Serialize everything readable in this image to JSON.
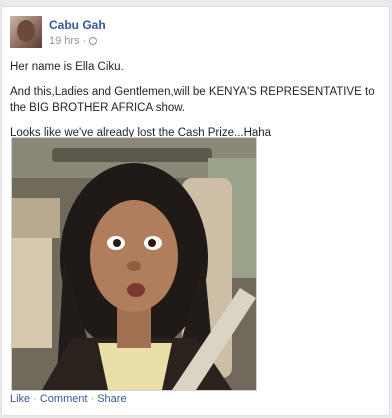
{
  "post": {
    "author": "Cabu Gah",
    "time": "19 hrs",
    "time_separator": "·",
    "paragraphs": [
      "Her name is Ella Ciku.",
      "And this,Ladies and Gentlemen,will be KENYA'S REPRESENTATIVE to the BIG BROTHER AFRICA show.",
      "Looks like we've already lost the Cash Prize...Haha"
    ],
    "photo_icon": "photo-of-woman-in-car"
  },
  "actions": {
    "like": "Like",
    "comment": "Comment",
    "share": "Share",
    "separator": "·"
  },
  "colors": {
    "link": "#365899",
    "meta": "#90949c",
    "text": "#1d2129",
    "background": "#e9ebee"
  }
}
